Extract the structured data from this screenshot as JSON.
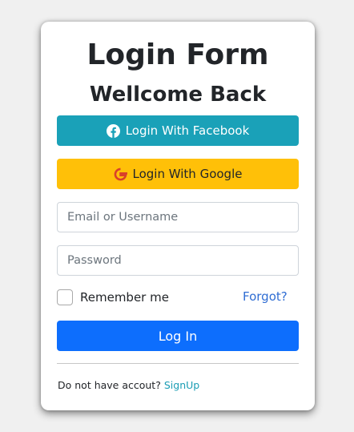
{
  "form": {
    "title": "Login Form",
    "subtitle": "Wellcome Back",
    "facebook_button": {
      "label": "Login With Facebook",
      "icon": "facebook-icon",
      "color": "#1aa1b8"
    },
    "google_button": {
      "label": "Login With Google",
      "icon": "google-icon",
      "color": "#ffc008"
    },
    "email_field": {
      "placeholder": "Email or Username",
      "value": ""
    },
    "password_field": {
      "placeholder": "Password",
      "value": ""
    },
    "remember": {
      "label": "Remember me",
      "checked": false
    },
    "forgot_link": "Forgot?",
    "login_button": {
      "label": "Log In",
      "color": "#0d6efd"
    },
    "footer": {
      "text": "Do not have accout?",
      "signup_link": "SignUp"
    }
  }
}
